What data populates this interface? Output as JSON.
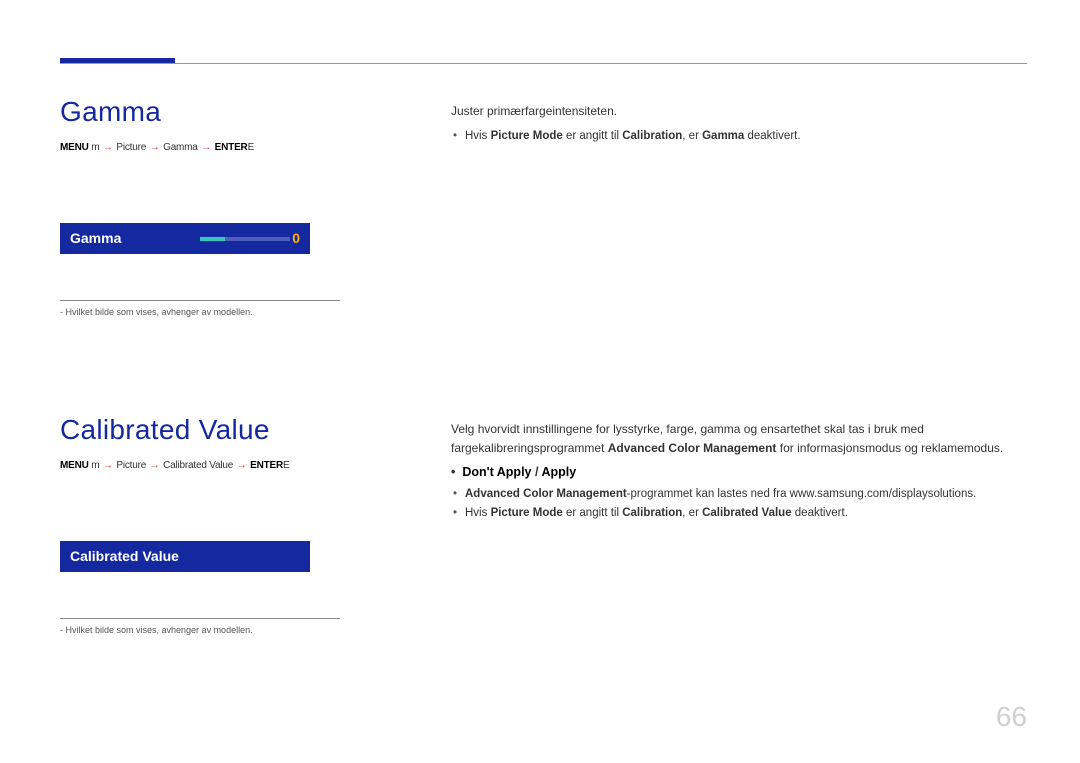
{
  "page_number": "66",
  "gamma": {
    "title": "Gamma",
    "trail_prefix": "MENU ",
    "trail_m": "m",
    "trail_step1": "Picture",
    "trail_step2": "Gamma",
    "trail_enter": "ENTER",
    "trail_e": "E",
    "slider_label": "Gamma",
    "slider_value": "0",
    "footnote": "Hvilket bilde som vises, avhenger av modellen.",
    "body": "Juster primærfargeintensiteten.",
    "bullet1_pre": "Hvis ",
    "bullet1_b1": "Picture Mode",
    "bullet1_mid": " er angitt til ",
    "bullet1_b2": "Calibration",
    "bullet1_post": ", er ",
    "bullet1_b3": "Gamma",
    "bullet1_end": " deaktivert."
  },
  "calibrated": {
    "title": "Calibrated Value",
    "trail_prefix": "MENU ",
    "trail_m": "m",
    "trail_step1": "Picture",
    "trail_step2": "Calibrated Value",
    "trail_enter": "ENTER",
    "trail_e": "E",
    "box_label": "Calibrated Value",
    "footnote": "Hvilket bilde som vises, avhenger av modellen.",
    "body1": "Velg hvorvidt innstillingene for lysstyrke, farge, gamma og ensartethet skal tas i bruk med fargekalibreringsprogrammet ",
    "body1_b": "Advanced Color Management",
    "body1_post": " for informasjonsmodus og reklamemodus.",
    "choice_a": "Don't Apply",
    "choice_sep": " / ",
    "choice_b": "Apply",
    "bullet1_pre": "",
    "bullet1_b": "Advanced Color Management",
    "bullet1_post": "-programmet kan lastes ned fra www.samsung.com/displaysolutions.",
    "bullet2_pre": "Hvis ",
    "bullet2_b1": "Picture Mode",
    "bullet2_mid": " er angitt til ",
    "bullet2_b2": "Calibration",
    "bullet2_post": ", er ",
    "bullet2_b3": "Calibrated Value",
    "bullet2_end": " deaktivert."
  }
}
